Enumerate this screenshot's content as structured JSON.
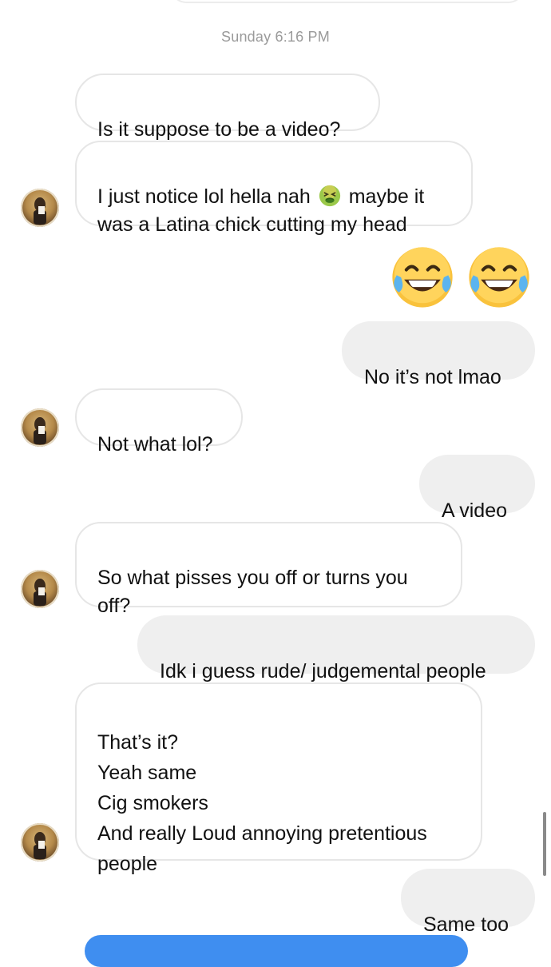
{
  "thread": {
    "timestamp": "Sunday 6:16 PM",
    "messages": [
      {
        "from": "them",
        "text": "Is it suppose to be a video?"
      },
      {
        "from": "them",
        "text_before": "I just notice lol hella nah ",
        "emoji": "nauseated-face-emoji",
        "text_after": " maybe it\nwas a Latina chick cutting my head"
      },
      {
        "from": "me",
        "emoji": [
          "face-with-tears-of-joy-emoji",
          "face-with-tears-of-joy-emoji"
        ]
      },
      {
        "from": "me",
        "text": "No it’s not lmao"
      },
      {
        "from": "them",
        "text": "Not what lol?"
      },
      {
        "from": "me",
        "text": "A video"
      },
      {
        "from": "them",
        "text": "So what pisses you off or turns you\noff?"
      },
      {
        "from": "me",
        "text": "Idk i guess rude/ judgemental people"
      },
      {
        "from": "them",
        "text": "That’s it?\nYeah same\nCig smokers\nAnd really Loud annoying pretentious\npeople"
      },
      {
        "from": "me",
        "text": "Same too"
      }
    ]
  },
  "colors": {
    "incoming_border": "#e6e6e6",
    "outgoing_bg": "#efefef",
    "timestamp": "#9a9a9a",
    "accent": "#3f8ef0"
  }
}
